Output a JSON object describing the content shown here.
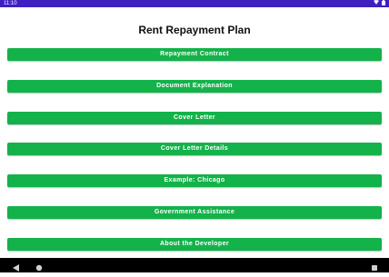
{
  "status_bar": {
    "time": "11:10",
    "icons": [
      "wifi-icon",
      "battery-icon"
    ]
  },
  "page": {
    "title": "Rent Repayment Plan"
  },
  "menu": {
    "buttons": [
      {
        "label": "Repayment Contract"
      },
      {
        "label": "Document Explanation"
      },
      {
        "label": "Cover Letter"
      },
      {
        "label": "Cover Letter Details"
      },
      {
        "label": "Example: Chicago"
      },
      {
        "label": "Government Assistance"
      },
      {
        "label": "About the Developer"
      }
    ]
  },
  "nav_bar": {
    "icons": [
      "back-icon",
      "home-icon",
      "recents-icon"
    ]
  },
  "colors": {
    "status_bar": "#3f1fc0",
    "button": "#14b24a",
    "nav_bar": "#000000"
  }
}
